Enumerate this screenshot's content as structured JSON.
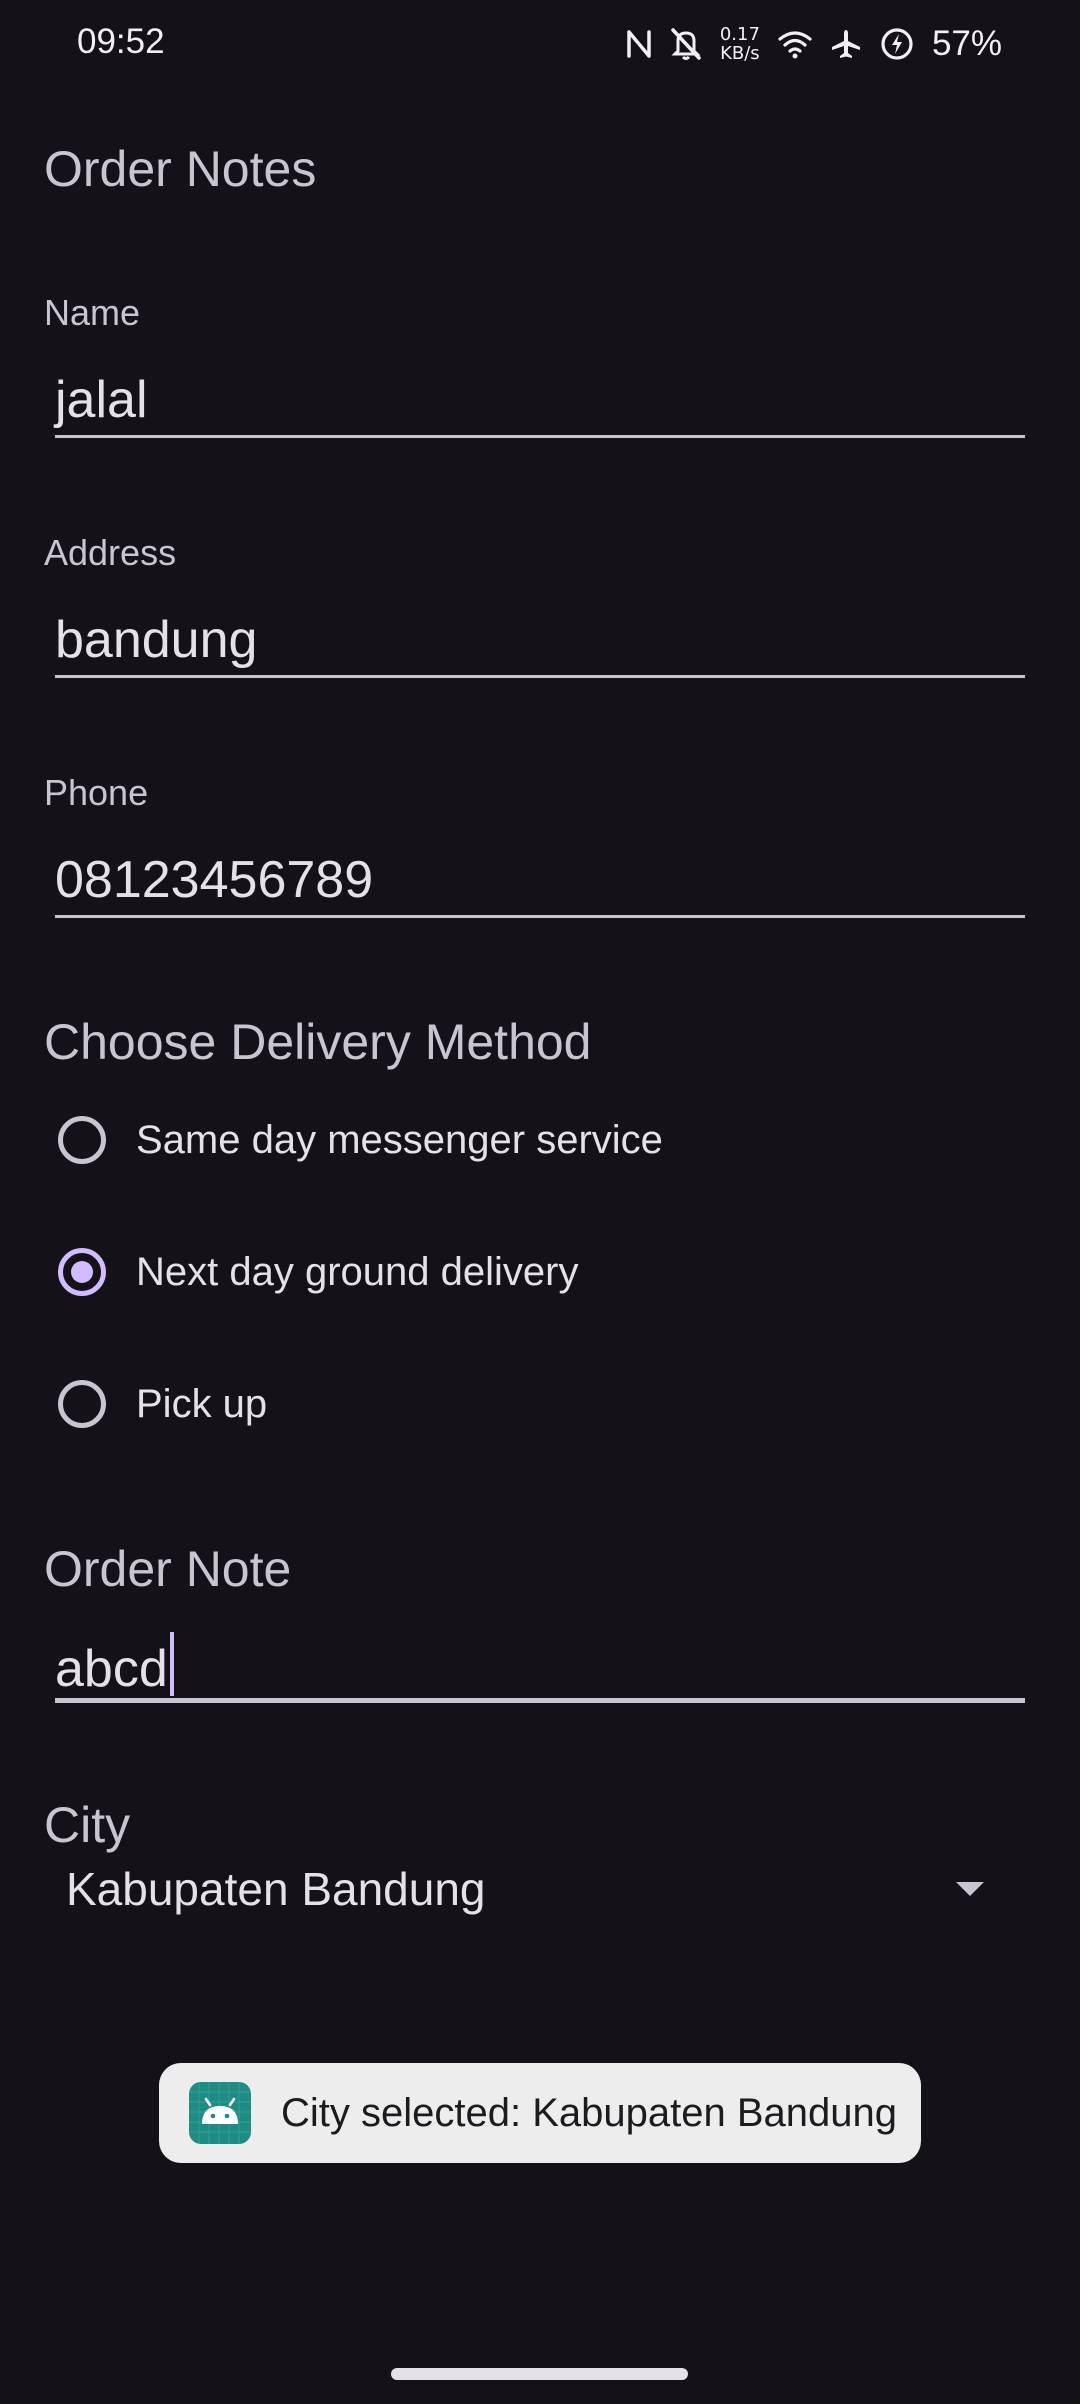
{
  "status_bar": {
    "time": "09:52",
    "net_speed_value": "0.17",
    "net_speed_unit": "KB/s",
    "battery": "57%",
    "icons": [
      "nfc-icon",
      "bell-off-icon",
      "wifi-icon",
      "airplane-icon",
      "battery-saver-icon"
    ]
  },
  "page": {
    "title": "Order Notes"
  },
  "fields": {
    "name": {
      "label": "Name",
      "value": "jalal"
    },
    "address": {
      "label": "Address",
      "value": "bandung"
    },
    "phone": {
      "label": "Phone",
      "value": "08123456789"
    }
  },
  "delivery": {
    "title": "Choose Delivery Method",
    "options": [
      {
        "label": "Same day messenger service",
        "checked": false
      },
      {
        "label": "Next day ground delivery",
        "checked": true
      },
      {
        "label": "Pick up",
        "checked": false
      }
    ]
  },
  "order_note": {
    "label": "Order Note",
    "value": "abcd"
  },
  "city": {
    "label": "City",
    "selected": "Kabupaten Bandung"
  },
  "toast": {
    "message": "City selected: Kabupaten Bandung",
    "icon": "android-app-icon"
  },
  "colors": {
    "background": "#141218",
    "accent": "#d0bcff",
    "label": "#cac4d0",
    "text": "#e6e0e9",
    "toast_bg": "#ededed"
  }
}
